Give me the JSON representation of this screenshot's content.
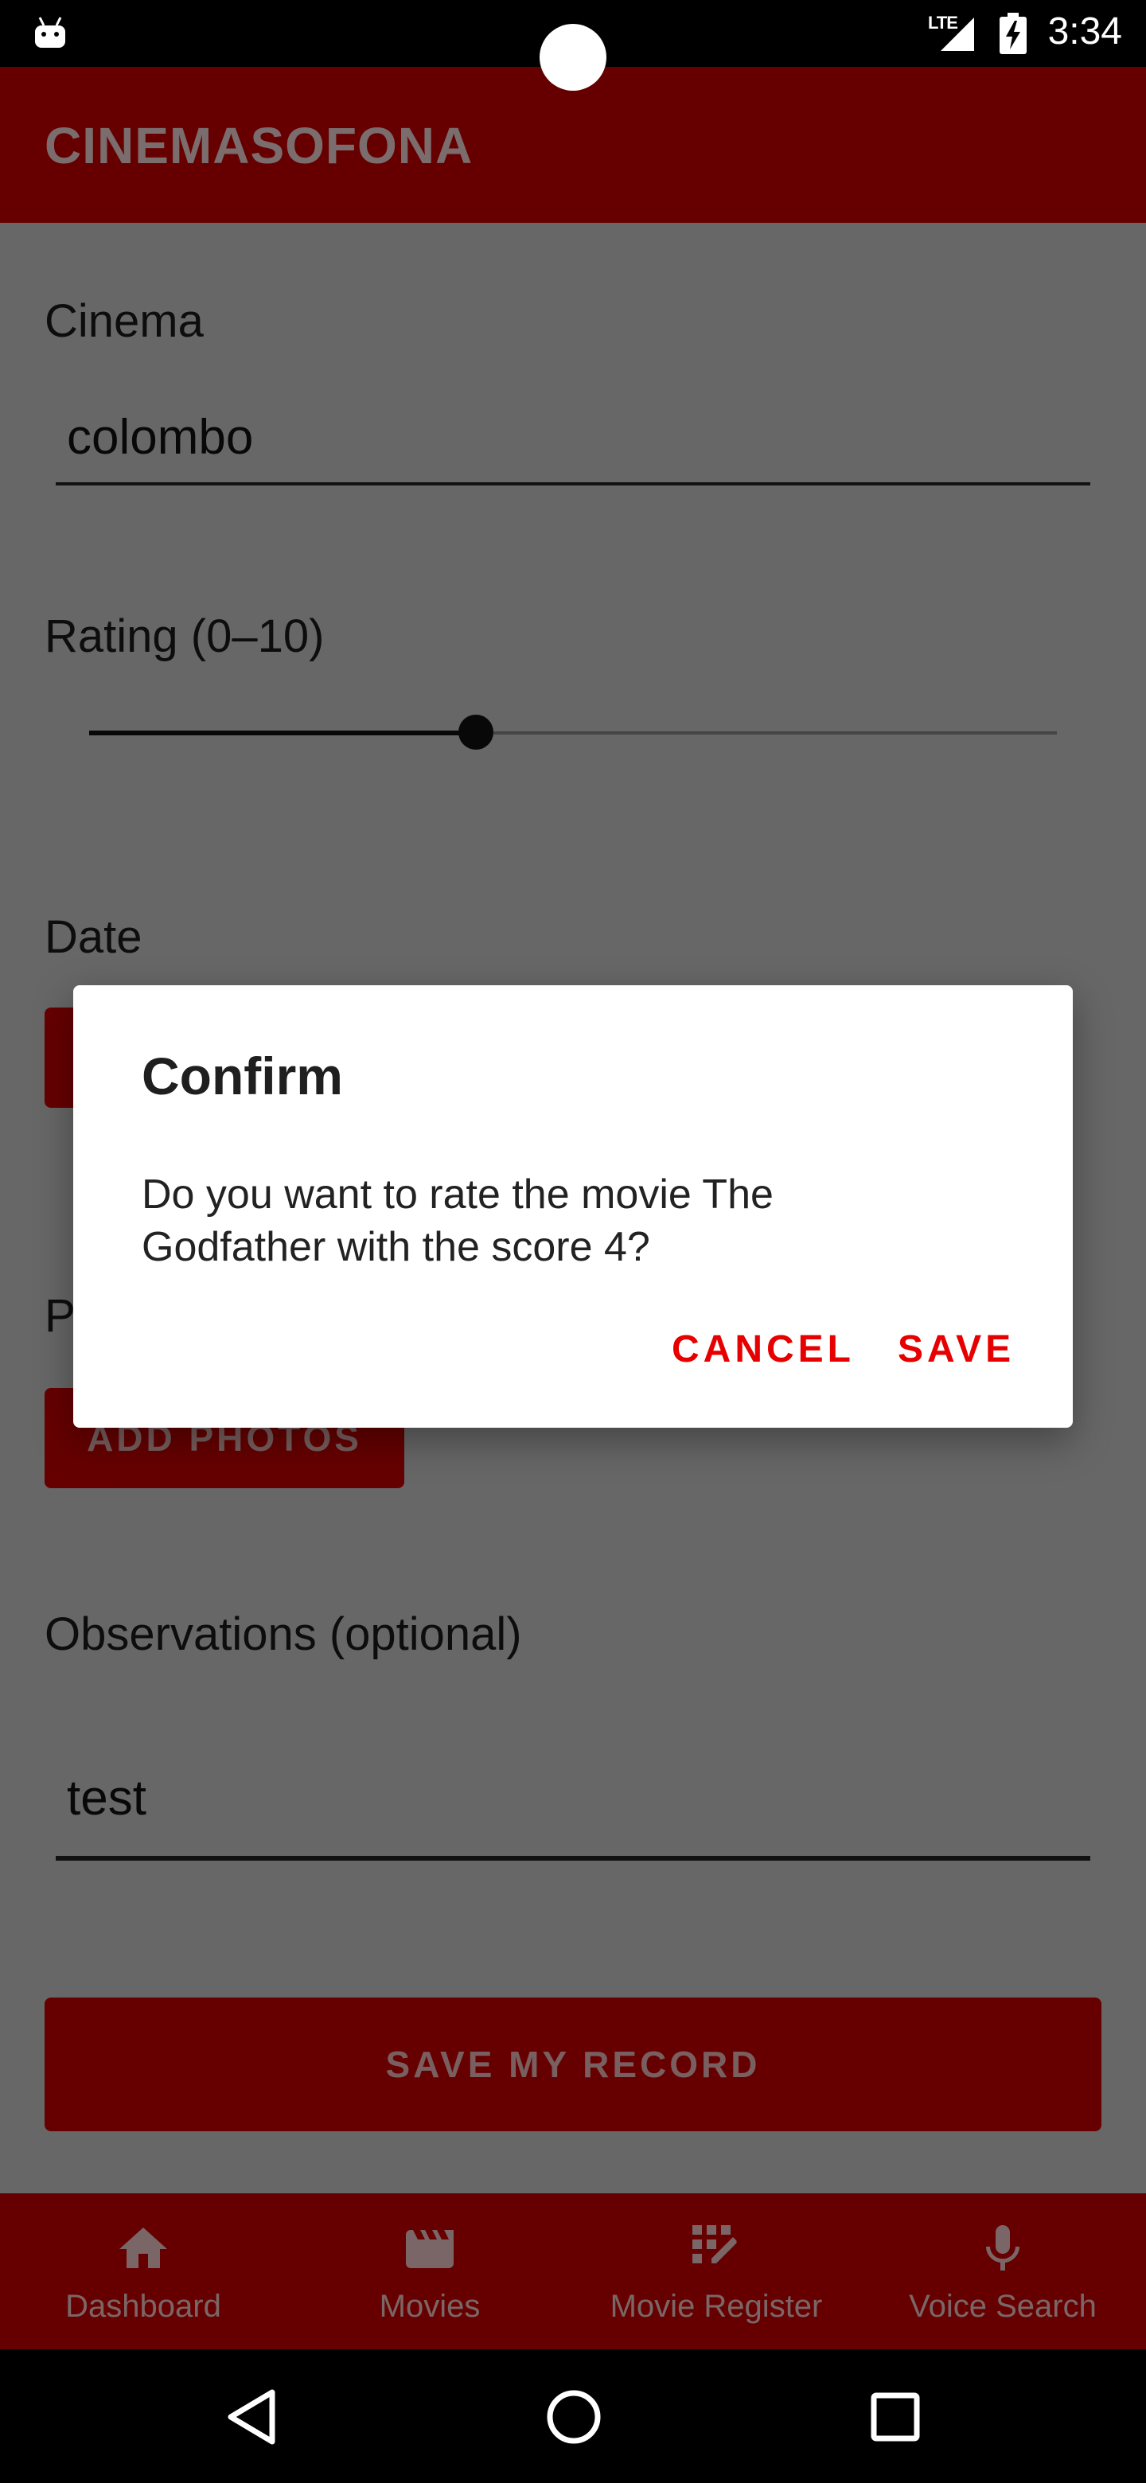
{
  "status_bar": {
    "network": "LTE",
    "time": "3:34"
  },
  "app": {
    "title": "CINEMASOFONA"
  },
  "form": {
    "cinema": {
      "label": "Cinema",
      "value": "colombo"
    },
    "rating": {
      "label": "Rating (0–10)",
      "value": 4,
      "min": 0,
      "max": 10
    },
    "date": {
      "label": "Date"
    },
    "photos": {
      "label": "P",
      "button_label": "ADD PHOTOS"
    },
    "observations": {
      "label": "Observations (optional)",
      "value": "test"
    },
    "submit_label": "SAVE MY RECORD"
  },
  "dialog": {
    "title": "Confirm",
    "message": "Do you want to rate the movie The Godfather with the score 4?",
    "cancel_label": "CANCEL",
    "save_label": "SAVE"
  },
  "bottom_nav": {
    "items": [
      {
        "label": "Dashboard",
        "icon": "home-icon"
      },
      {
        "label": "Movies",
        "icon": "clapperboard-icon"
      },
      {
        "label": "Movie Register",
        "icon": "edit-grid-icon"
      },
      {
        "label": "Voice Search",
        "icon": "microphone-icon"
      }
    ]
  },
  "colors": {
    "primary": "#cc0000",
    "dialog_action": "#e60000",
    "background": "#cecece"
  }
}
